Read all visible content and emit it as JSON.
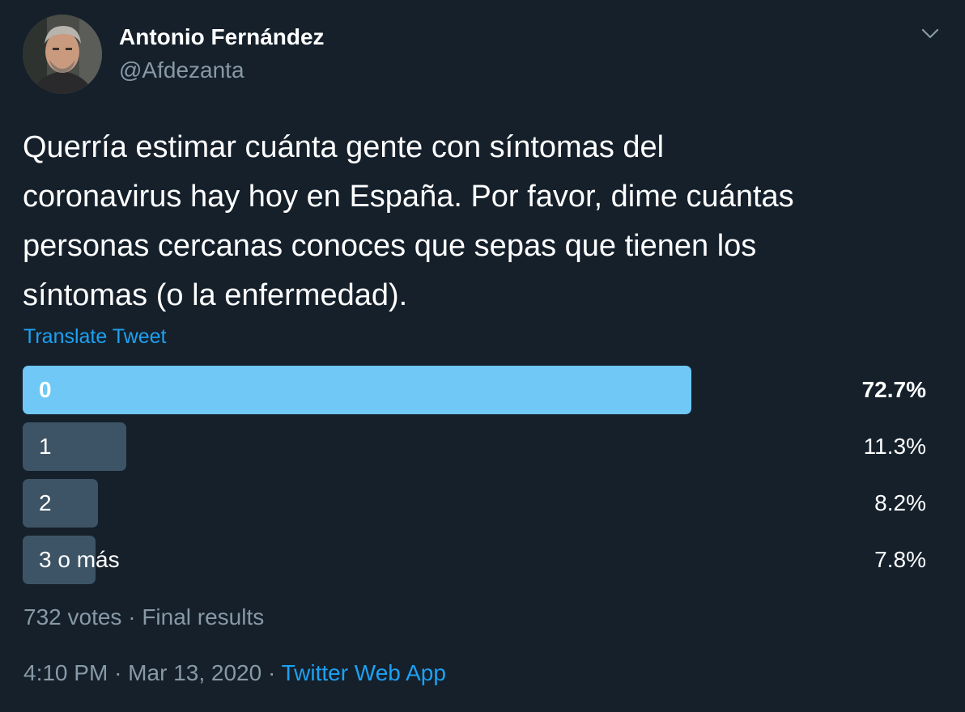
{
  "author": {
    "display_name": "Antonio Fernández",
    "handle": "@Afdezanta"
  },
  "menu_icon": "chevron-down-icon",
  "tweet": {
    "text": "Querría estimar cuánta gente con síntomas del\ncoronavirus hay hoy en España. Por favor, dime cuántas\npersonas cercanas conoces que sepas que tienen los\nsíntomas (o la enfermedad).",
    "translate_label": "Translate Tweet"
  },
  "poll": {
    "options": [
      {
        "label": "0",
        "percent_text": "72.7%",
        "percent": 72.7,
        "winner": true
      },
      {
        "label": "1",
        "percent_text": "11.3%",
        "percent": 11.3,
        "winner": false
      },
      {
        "label": "2",
        "percent_text": "8.2%",
        "percent": 8.2,
        "winner": false
      },
      {
        "label": "3 o más",
        "percent_text": "7.8%",
        "percent": 7.8,
        "winner": false
      }
    ],
    "votes": "732 votes",
    "separator": "·",
    "status": "Final results"
  },
  "meta": {
    "time": "4:10 PM",
    "separator1": "·",
    "date": "Mar 13, 2020",
    "separator2": "·",
    "source": "Twitter Web App"
  },
  "colors": {
    "background": "#15202b",
    "winner_bar": "#6fc8f6",
    "bar": "#3d5466",
    "link": "#1da1f2",
    "secondary_text": "#8899a6"
  }
}
